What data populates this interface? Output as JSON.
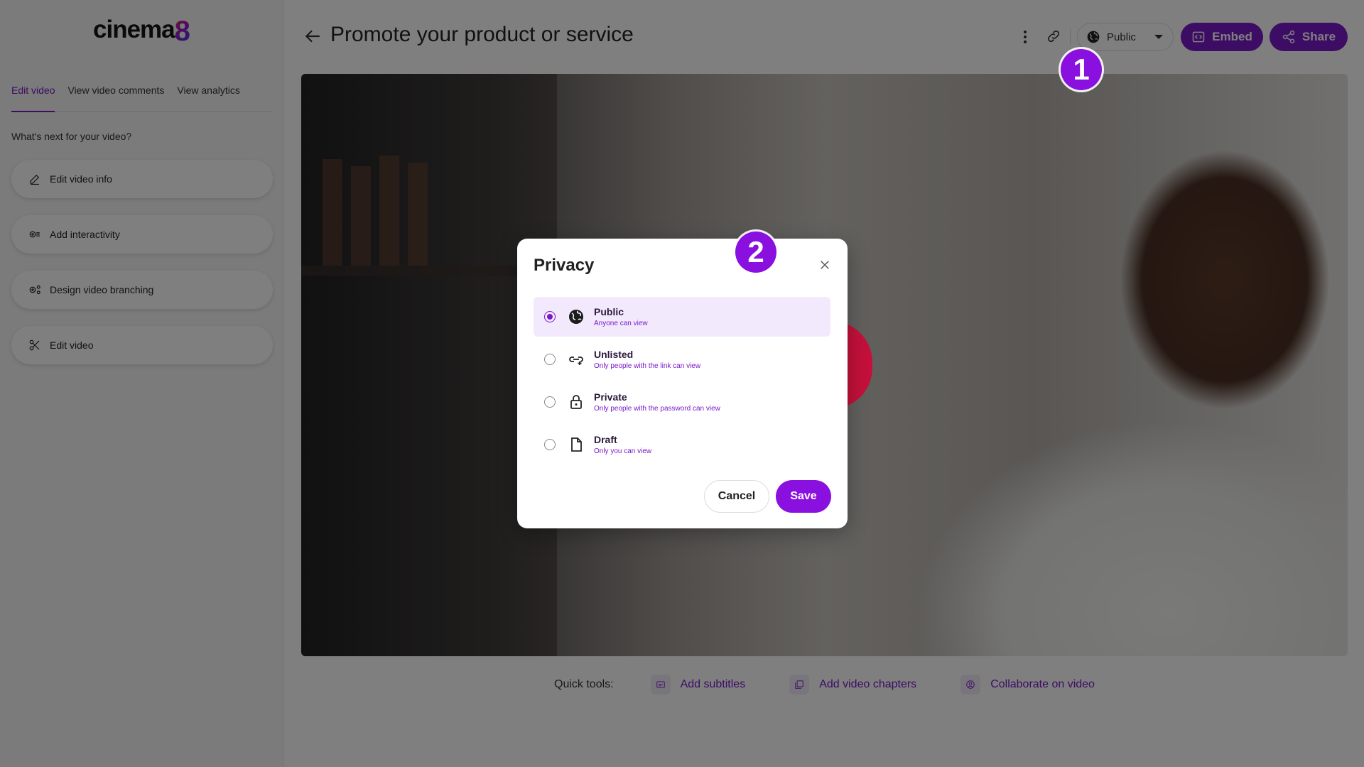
{
  "brand": {
    "logo_text": "cinema",
    "logo_digit": "8"
  },
  "sidebar": {
    "tabs": [
      {
        "label": "Edit video",
        "active": true
      },
      {
        "label": "View video comments",
        "active": false
      },
      {
        "label": "View analytics",
        "active": false
      }
    ],
    "next_label": "What's next for your video?",
    "actions": [
      {
        "label": "Edit video info",
        "icon": "pencil-icon"
      },
      {
        "label": "Add interactivity",
        "icon": "interactivity-icon"
      },
      {
        "label": "Design video branching",
        "icon": "branching-icon"
      },
      {
        "label": "Edit video",
        "icon": "scissors-icon"
      }
    ]
  },
  "header": {
    "title": "Promote your product or service",
    "privacy_value": "Public",
    "embed_label": "Embed",
    "share_label": "Share"
  },
  "quick_tools": {
    "label": "Quick tools:",
    "items": [
      {
        "label": "Add subtitles",
        "icon": "subtitles-icon"
      },
      {
        "label": "Add video chapters",
        "icon": "chapters-icon"
      },
      {
        "label": "Collaborate on video",
        "icon": "collaborate-icon"
      }
    ]
  },
  "markers": {
    "one": "1",
    "two": "2"
  },
  "modal": {
    "title": "Privacy",
    "options": [
      {
        "label": "Public",
        "desc": "Anyone can view",
        "icon": "globe-icon",
        "selected": true
      },
      {
        "label": "Unlisted",
        "desc": "Only people with the link can view",
        "icon": "link-icon",
        "selected": false
      },
      {
        "label": "Private",
        "desc": "Only people with the password can view",
        "icon": "lock-icon",
        "selected": false
      },
      {
        "label": "Draft",
        "desc": "Only you can view",
        "icon": "document-icon",
        "selected": false
      }
    ],
    "cancel_label": "Cancel",
    "save_label": "Save"
  },
  "colors": {
    "accent": "#7a18c9",
    "marker": "#8a10e0",
    "overlay": "rgba(0,0,0,0.5)"
  }
}
